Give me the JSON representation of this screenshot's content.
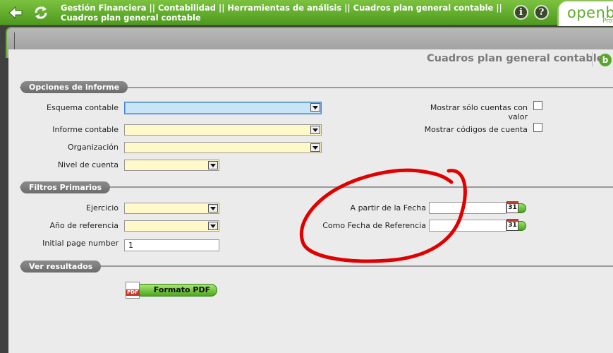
{
  "header": {
    "breadcrumb": "Gestión Financiera || Contabilidad || Herramientas de análisis || Cuadros plan general contable || Cuadros plan general contable",
    "info_label": "i",
    "help_label": "?",
    "logo_text": "openbr",
    "logo_sub": "Prof"
  },
  "window": {
    "title": "Cuadros plan general contable",
    "tab_logo": "b"
  },
  "sections": {
    "options": "Opciones de informe",
    "filters": "Filtros Primarios",
    "results": "Ver resultados"
  },
  "options": {
    "esquema_label": "Esquema contable",
    "informe_label": "Informe contable",
    "organizacion_label": "Organización",
    "nivel_label": "Nivel de cuenta",
    "mostrar_cuentas_label": "Mostrar sólo cuentas con valor",
    "mostrar_codigos_label": "Mostrar códigos de cuenta"
  },
  "filters": {
    "ejercicio_label": "Ejercicio",
    "ano_label": "Año de referencia",
    "initial_page_label": "Initial page number",
    "initial_page_value": "1",
    "desde_fecha_label": "A partir de la Fecha",
    "ref_fecha_label": "Como Fecha de Referencia",
    "calendar_day": "31"
  },
  "results": {
    "pdf_button": "Formato PDF",
    "pdf_icon_text": "PDF"
  },
  "colors": {
    "nav_green": "#5faa2a",
    "select_yellow": "#fff8c8",
    "select_focus_blue": "#c8e4f7",
    "annotation_red": "#e00000"
  }
}
